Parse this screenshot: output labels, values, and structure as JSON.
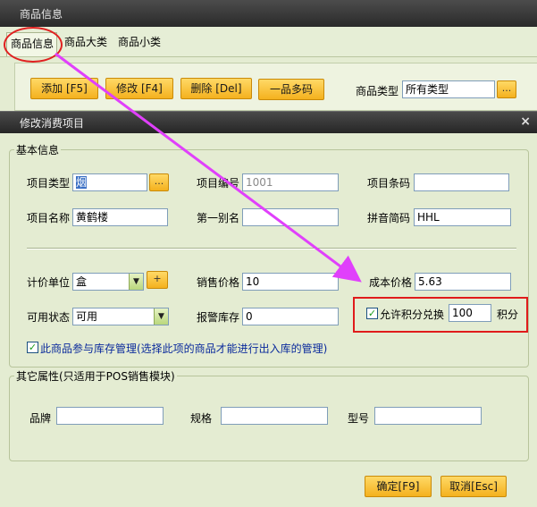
{
  "bg_window": {
    "title": "商品信息",
    "tabs": [
      {
        "label": "商品信息",
        "active": true
      },
      {
        "label": "商品大类",
        "active": false
      },
      {
        "label": "商品小类",
        "active": false
      }
    ],
    "toolbar": {
      "add": "添加 [F5]",
      "edit": "修改 [F4]",
      "delete": "删除 [Del]",
      "multi_code": "一品多码"
    },
    "product_type_label": "商品类型",
    "product_type_value": "所有类型",
    "ellipsis": "..."
  },
  "dialog": {
    "title": "修改消费项目",
    "close": "×",
    "basic_group_title": "基本信息",
    "item_type_label": "项目类型",
    "item_type_value": "烟",
    "ellipsis": "...",
    "item_code_label": "项目编号",
    "item_code_value": "1001",
    "barcode_label": "项目条码",
    "barcode_value": "",
    "item_name_label": "项目名称",
    "item_name_value": "黄鹤楼",
    "alias_label": "第一别名",
    "alias_value": "",
    "pinyin_label": "拼音简码",
    "pinyin_value": "HHL",
    "unit_label": "计价单位",
    "unit_value": "盒",
    "plus": "+",
    "sale_price_label": "销售价格",
    "sale_price_value": "10",
    "cost_price_label": "成本价格",
    "cost_price_value": "5.63",
    "status_label": "可用状态",
    "status_value": "可用",
    "alarm_stock_label": "报警库存",
    "alarm_stock_value": "0",
    "points_exchange_label": "允许积分兑换",
    "points_exchange_checked": true,
    "points_value": "100",
    "points_unit": "积分",
    "inventory_label": "此商品参与库存管理(选择此项的商品才能进行出入库的管理)",
    "inventory_checked": true,
    "other_group_title": "其它属性(只适用于POS销售模块)",
    "brand_label": "品牌",
    "brand_value": "",
    "spec_label": "规格",
    "spec_value": "",
    "model_label": "型号",
    "model_value": "",
    "ok_button": "确定[F9]",
    "cancel_button": "取消[Esc]"
  },
  "colors": {
    "annotation_red": "#e01b1b",
    "arrow_magenta": "#e040fb",
    "button_orange": "#f4b11e",
    "dialog_bg": "#e4ecd2"
  }
}
